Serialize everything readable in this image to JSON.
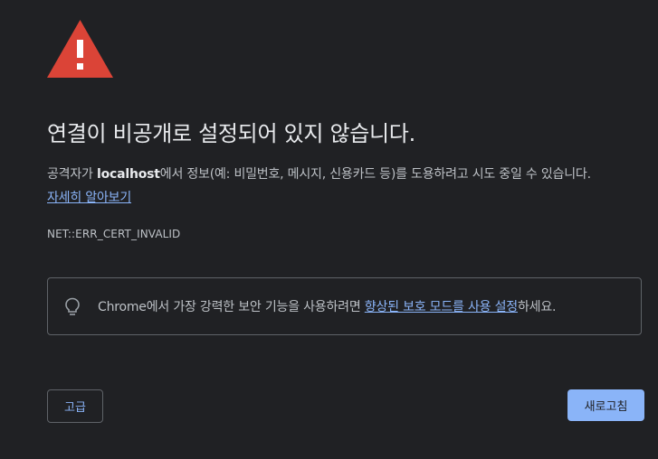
{
  "colors": {
    "background": "#202124",
    "heading": "#e8eaed",
    "text": "#bdc1c6",
    "link": "#8ab4f8",
    "warning_red": "#db4437",
    "border": "#5f6368"
  },
  "icons": {
    "warning": "warning-triangle-icon",
    "promo": "lightbulb-icon"
  },
  "heading": "연결이 비공개로 설정되어 있지 않습니다.",
  "body": {
    "prefix": "공격자가 ",
    "host": "localhost",
    "suffix": "에서 정보(예: 비밀번호, 메시지, 신용카드 등)를 도용하려고 시도 중일 수 있습니다.",
    "learn_more": "자세히 알아보기"
  },
  "error_code": "NET::ERR_CERT_INVALID",
  "promo": {
    "prefix": "Chrome에서 가장 강력한 보안 기능을 사용하려면 ",
    "link": "향상된 보호 모드를 사용 설정",
    "suffix": "하세요."
  },
  "buttons": {
    "advanced": "고급",
    "reload": "새로고침"
  }
}
